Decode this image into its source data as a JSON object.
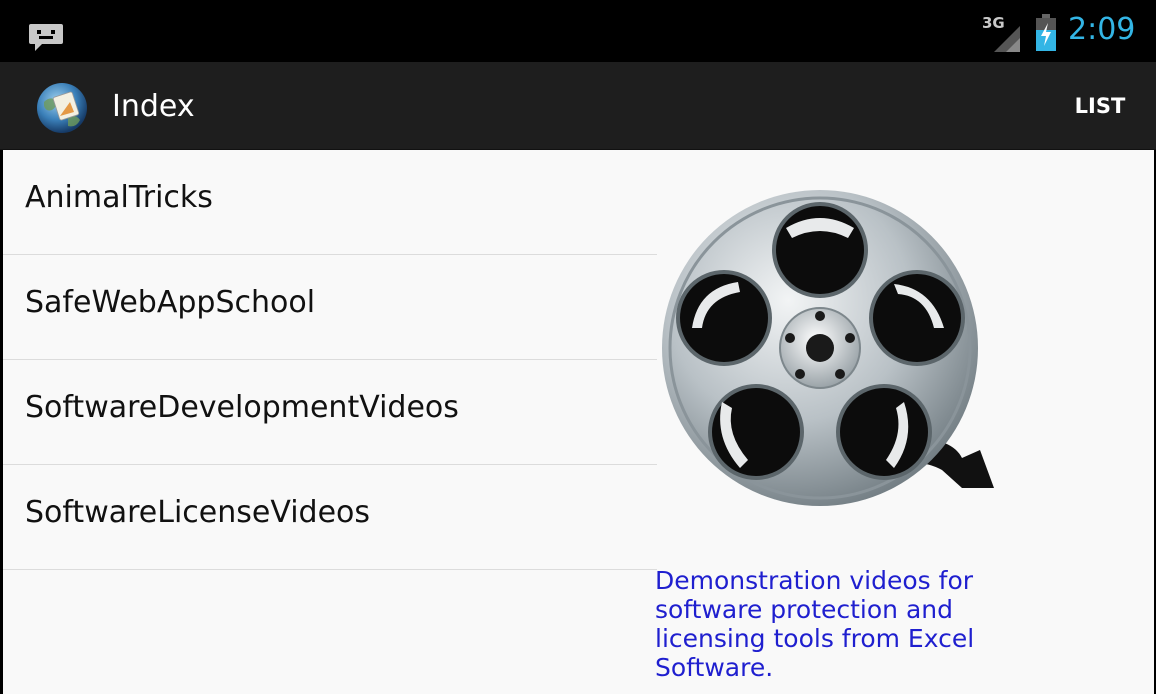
{
  "status_bar": {
    "network": "3G",
    "time": "2:09",
    "icons": [
      "notification-chat-icon",
      "signal-icon",
      "battery-charging-icon"
    ],
    "colors": {
      "time": "#33b5e5",
      "background": "#000000"
    }
  },
  "action_bar": {
    "title": "Index",
    "action_label": "LIST",
    "icon": "app-globe-icon",
    "colors": {
      "background": "#1e1e1e",
      "text": "#ffffff"
    }
  },
  "list": {
    "items": [
      {
        "label": "AnimalTricks"
      },
      {
        "label": "SafeWebAppSchool"
      },
      {
        "label": "SoftwareDevelopmentVideos"
      },
      {
        "label": "SoftwareLicenseVideos"
      }
    ]
  },
  "detail": {
    "image": "film-reel-icon",
    "description": "Demonstration videos for software protection and licensing tools from Excel Software.",
    "colors": {
      "description": "#1f1fcf"
    }
  }
}
